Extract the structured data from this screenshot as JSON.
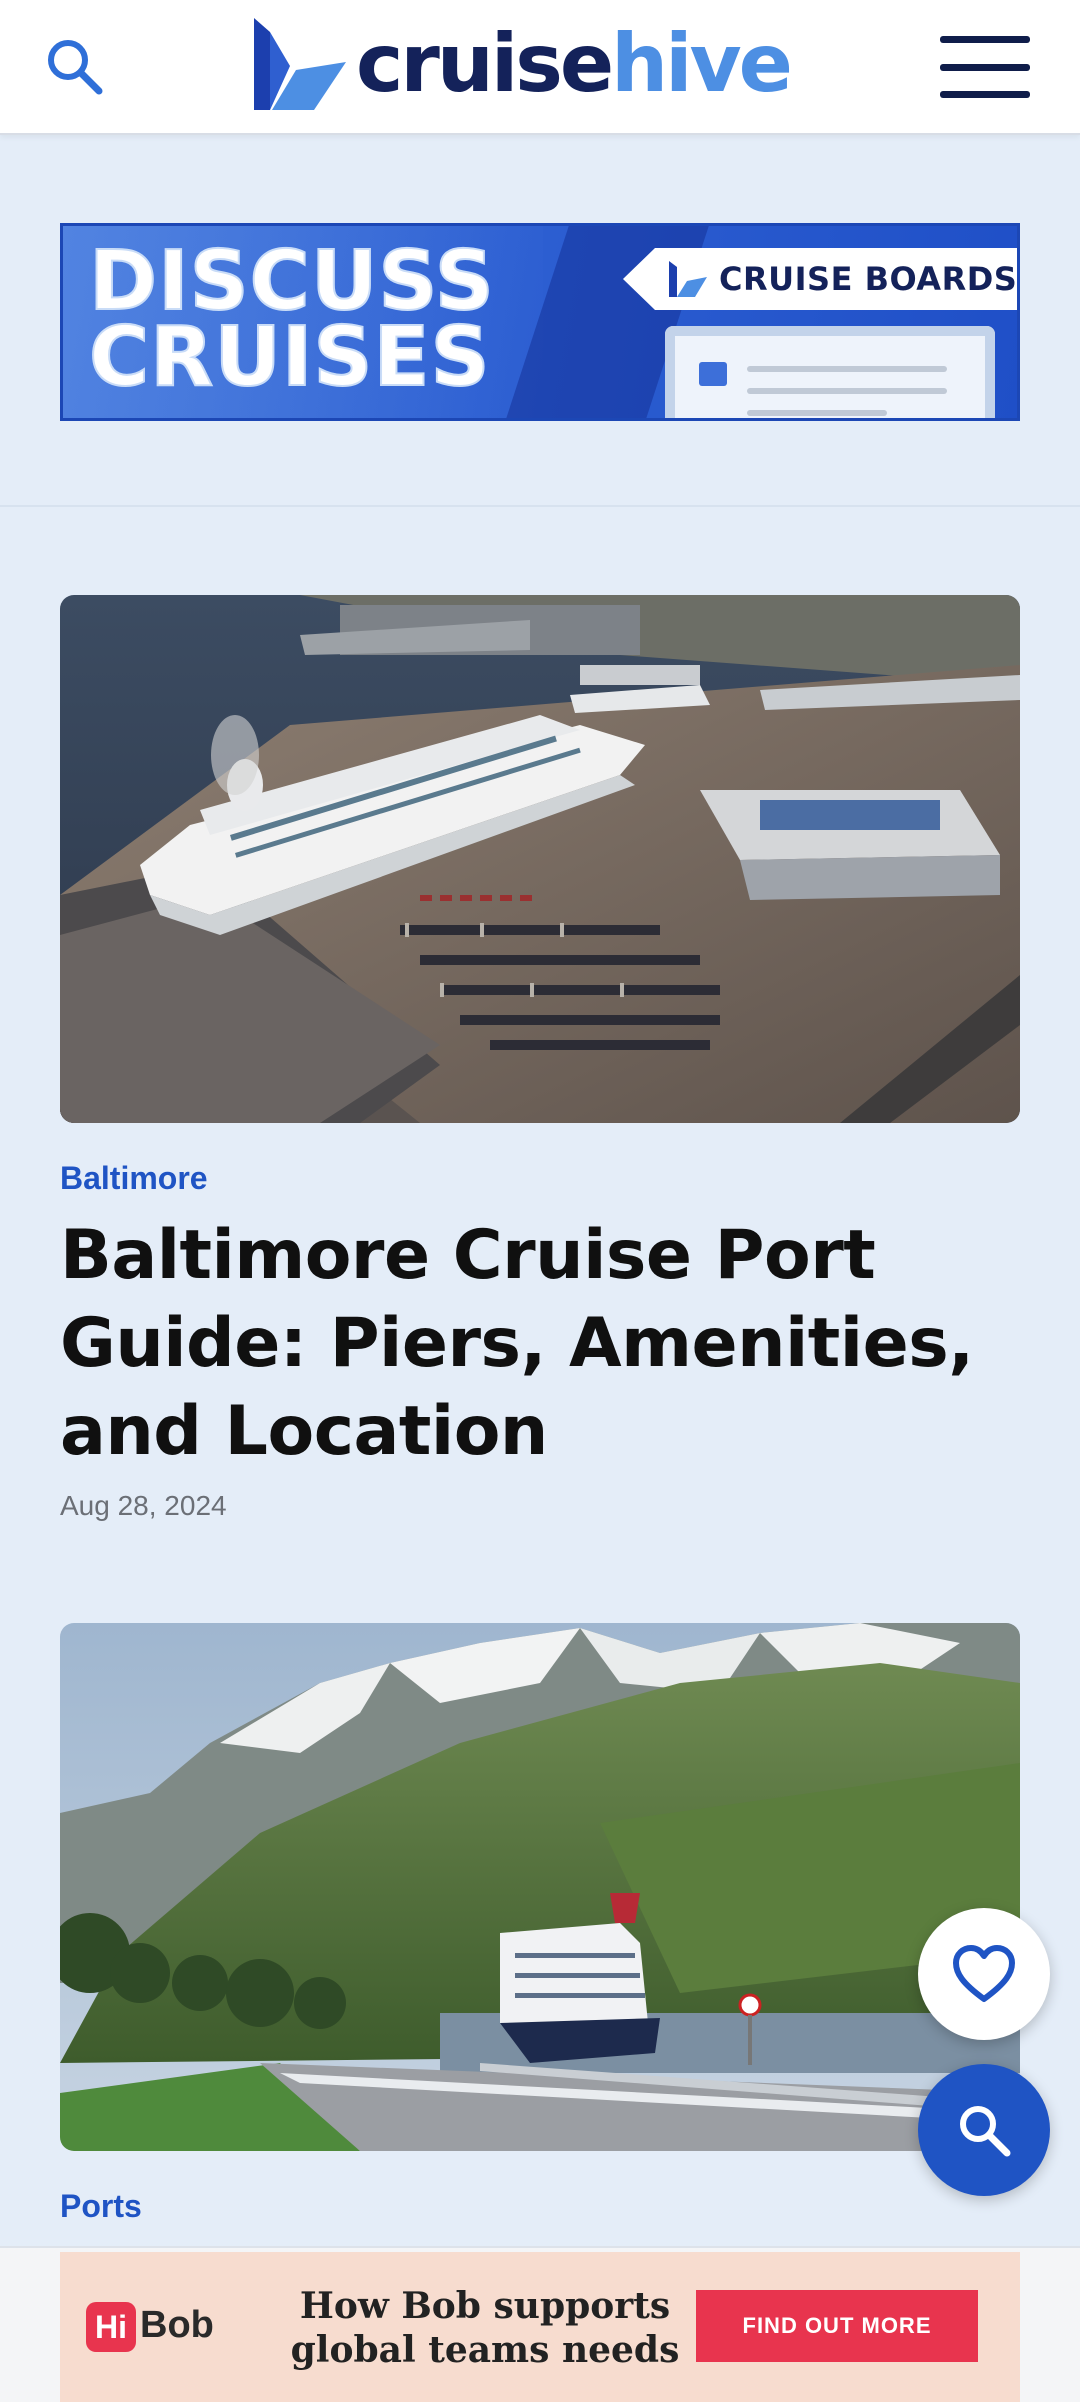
{
  "header": {
    "logo_part1": "cruise",
    "logo_part2": "hive"
  },
  "promo_banner": {
    "title_line1": "DISCUSS",
    "title_line2": "CRUISES",
    "tag_label": "CRUISE BOARDS"
  },
  "articles": [
    {
      "category": "Baltimore",
      "title": "Baltimore Cruise Port Guide: Piers, Amenities, and Location",
      "date": "Aug 28, 2024"
    },
    {
      "category": "Ports"
    }
  ],
  "ad": {
    "brand_badge": "Hi",
    "brand_text": "Bob",
    "copy": "How Bob supports global teams needs",
    "cta": "FIND OUT MORE"
  },
  "colors": {
    "brand_navy": "#14225a",
    "brand_blue": "#4d8fe3",
    "accent_blue": "#1f54c4",
    "page_bg": "#e4edf8",
    "ad_red": "#e8344e"
  },
  "icons": {
    "header_search": "search-icon",
    "menu": "hamburger-menu-icon",
    "favorite": "heart-icon",
    "fab_search": "search-icon"
  }
}
